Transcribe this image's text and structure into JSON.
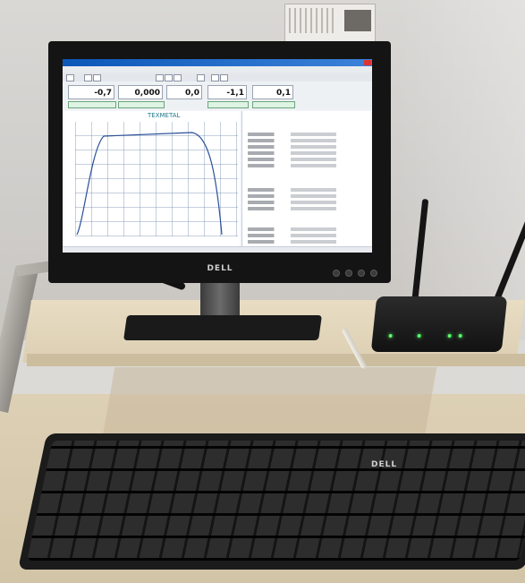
{
  "scene": {
    "monitor_logo": "DELL",
    "keyboard_logo": "DELL"
  },
  "software": {
    "chart_title": "TEXMETAL",
    "readouts": [
      "-0,7",
      "0,000",
      "0,0",
      "-1,1",
      "0,1"
    ]
  },
  "colors": {
    "title_bar": "#0b57b8",
    "router_led": "#59ff6a",
    "chart_title": "#1f7a8c"
  }
}
